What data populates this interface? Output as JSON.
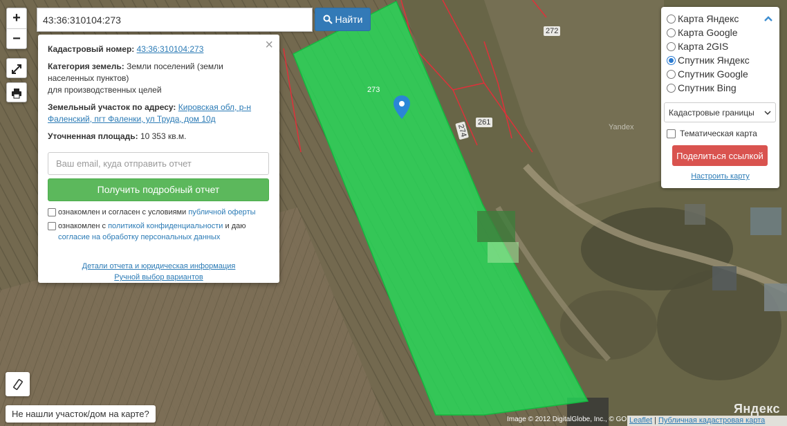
{
  "search": {
    "value": "43:36:310104:273",
    "button_label": "Найти"
  },
  "zoom": {
    "in": "+",
    "out": "−"
  },
  "map_labels": {
    "plot_273": "273",
    "plot_272": "272",
    "plot_261": "261",
    "plot_274": "274",
    "yandex_watermark": "Yandex",
    "yandex_logo": "Яндекс"
  },
  "popup": {
    "cadastral_label": "Кадастровый номер:",
    "cadastral_value": "43:36:310104:273",
    "category_label": "Категория земель:",
    "category_value_1": "Земли поселений (земли населенных пунктов)",
    "category_value_2": "для производственных целей",
    "address_label": "Земельный участок по адресу:",
    "address_value": "Кировская обл, р-н Фаленский, пгт Фаленки, ул Труда, дом 10д",
    "area_label": "Уточненная площадь:",
    "area_value": "10 353 кв.м.",
    "email_placeholder": "Ваш email, куда отправить отчет",
    "report_button": "Получить подробный отчет",
    "agree1_text": "ознакомлен и согласен с условиями",
    "agree1_link": "публичной оферты",
    "agree2_text_a": "ознакомлен с",
    "agree2_link_a": "политикой конфиденциальности",
    "agree2_text_b": "и даю",
    "agree2_link_b": "согласие на обработку персональных данных",
    "details_link": "Детали отчета и юридическая информация",
    "manual_link": "Ручной выбор вариантов"
  },
  "layers": {
    "options": [
      {
        "label": "Карта Яндекс",
        "checked": false
      },
      {
        "label": "Карта Google",
        "checked": false
      },
      {
        "label": "Карта 2GIS",
        "checked": false
      },
      {
        "label": "Спутник Яндекс",
        "checked": true
      },
      {
        "label": "Спутник Google",
        "checked": false
      },
      {
        "label": "Спутник Bing",
        "checked": false
      }
    ],
    "overlay_select": "Кадастровые границы",
    "thematic_label": "Тематическая карта",
    "share_button": "Поделиться ссылкой",
    "settings_link": "Настроить карту"
  },
  "bottom": {
    "not_found": "Не нашли участок/дом на карте?",
    "attribution": "Image © 2012 DigitalGlobe, Inc., © GO",
    "leaflet": "Leaflet",
    "pkk": "Публичная кадастровая карта"
  },
  "colors": {
    "plot_fill": "#22e05a",
    "marker": "#2a86d6",
    "search_button": "#337ab7",
    "report_button": "#5cb85c",
    "share_button": "#d9534f"
  }
}
